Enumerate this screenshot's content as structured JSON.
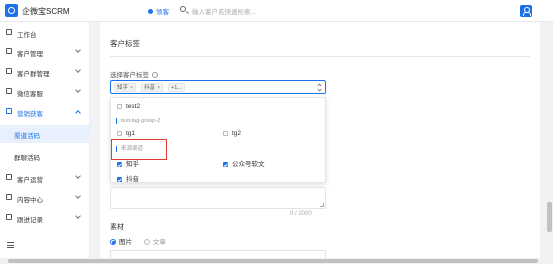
{
  "header": {
    "app_name": "企微宝SCRM",
    "mode_label": "领客",
    "search_placeholder": "输入客户名快速检索..."
  },
  "sidebar": {
    "items": [
      {
        "label": "工作台"
      },
      {
        "label": "客户管理"
      },
      {
        "label": "客户群管理"
      },
      {
        "label": "微信客服"
      },
      {
        "label": "营销获客"
      },
      {
        "label": "渠道活码"
      },
      {
        "label": "群聊活码"
      },
      {
        "label": "客户运营"
      },
      {
        "label": "内容中心"
      },
      {
        "label": "跟进记录"
      }
    ]
  },
  "main": {
    "section_title": "客户标签",
    "field_label": "选择客户标签",
    "selected_tags": [
      {
        "label": "知乎"
      },
      {
        "label": "抖音"
      },
      {
        "label": "+1..."
      }
    ],
    "dropdown": {
      "options_top": [
        {
          "label": "test2",
          "checked": false
        }
      ],
      "group1": "test-tag-group-2",
      "group1_options": [
        {
          "label": "tg1",
          "checked": false
        },
        {
          "label": "tg2",
          "checked": false
        }
      ],
      "group2": "来源渠道",
      "group2_options": [
        {
          "label": "知乎",
          "checked": true
        },
        {
          "label": "公众号软文",
          "checked": true
        },
        {
          "label": "抖音",
          "checked": true
        }
      ]
    },
    "counter": "0 / 2000",
    "material_label": "素材",
    "radio_options": [
      {
        "label": "图片",
        "selected": true
      },
      {
        "label": "文章",
        "selected": false
      }
    ]
  },
  "colors": {
    "accent": "#1a73e8",
    "highlight_red": "#e53935"
  }
}
